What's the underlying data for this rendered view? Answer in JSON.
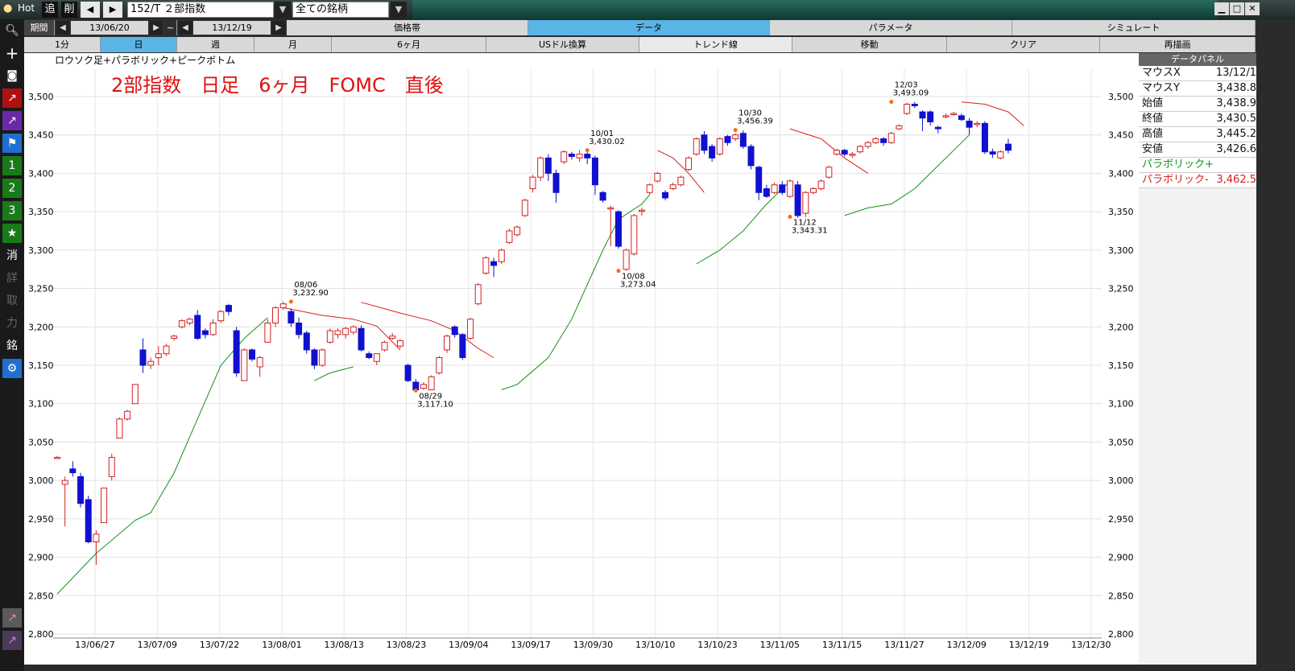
{
  "titlebar": {
    "hot": "Hot",
    "add": "追",
    "del": "削",
    "symbol": "152/T ２部指数",
    "universe": "全ての銘柄"
  },
  "period": {
    "label": "期間",
    "start": "13/06/20",
    "sep": "~",
    "end": "13/12/19"
  },
  "top_tabs": [
    "価格帯",
    "データ",
    "パラメータ",
    "シミュレート"
  ],
  "timeframes": [
    "1分",
    "日",
    "週",
    "月",
    "6ヶ月",
    "USドル換算"
  ],
  "tools": [
    "トレンド線",
    "移動",
    "クリア",
    "再描画"
  ],
  "left_buttons": [
    "1",
    "2",
    "3",
    "消",
    "詳",
    "取",
    "力",
    "銘"
  ],
  "chart": {
    "indicator_label": "ロウソク足+パラボリック+ピークボトム",
    "headline": "2部指数　日足　6ヶ月　FOMC　直後"
  },
  "panel": {
    "title": "データパネル",
    "rows": [
      {
        "k": "マウスX",
        "v": "13/12/1"
      },
      {
        "k": "マウスY",
        "v": "3,438.8"
      },
      {
        "k": "始値",
        "v": "3,438.9"
      },
      {
        "k": "終値",
        "v": "3,430.5"
      },
      {
        "k": "高値",
        "v": "3,445.2"
      },
      {
        "k": "安値",
        "v": "3,426.6"
      }
    ],
    "sar_plus": "パラボリック+",
    "sar_minus": "パラボリック-",
    "sar_minus_value": "3,462.5"
  },
  "colors": {
    "up": "#d42020",
    "down": "#1010d0",
    "sar_up": "#189018",
    "sar_down": "#d42020",
    "peak": "#ff6a00",
    "headline": "#e01010"
  },
  "chart_data": {
    "type": "candlestick",
    "ylim": [
      2800,
      3550
    ],
    "y_ticks": [
      "3,500",
      "3,450",
      "3,400",
      "3,350",
      "3,300",
      "3,250",
      "3,200",
      "3,150",
      "3,100",
      "3,050",
      "3,000",
      "2,950",
      "2,900",
      "2,850",
      "2,800"
    ],
    "x_ticks": [
      "13/06/27",
      "13/07/09",
      "13/07/22",
      "13/08/01",
      "13/08/13",
      "13/08/23",
      "13/09/04",
      "13/09/17",
      "13/09/30",
      "13/10/10",
      "13/10/23",
      "13/11/05",
      "13/11/15",
      "13/11/27",
      "13/12/09",
      "13/12/19",
      "13/12/30"
    ],
    "peaks": [
      {
        "date": "08/06",
        "value": "3,232.90",
        "price": 3232.9,
        "idx": 30,
        "type": "peak"
      },
      {
        "date": "08/29",
        "value": "3,117.10",
        "price": 3117.1,
        "idx": 46,
        "type": "bottom"
      },
      {
        "date": "10/01",
        "value": "3,430.02",
        "price": 3430.02,
        "idx": 68,
        "type": "peak"
      },
      {
        "date": "10/08",
        "value": "3,273.04",
        "price": 3273.04,
        "idx": 72,
        "type": "bottom"
      },
      {
        "date": "10/30",
        "value": "3,456.39",
        "price": 3456.39,
        "idx": 87,
        "type": "peak"
      },
      {
        "date": "11/12",
        "value": "3,343.31",
        "price": 3343.31,
        "idx": 94,
        "type": "bottom"
      },
      {
        "date": "12/03",
        "value": "3,493.09",
        "price": 3493.09,
        "idx": 107,
        "type": "peak"
      }
    ],
    "candles": [
      [
        3030,
        3030,
        3028,
        3032
      ],
      [
        2995,
        3000,
        2940,
        3005
      ],
      [
        3015,
        3010,
        3005,
        3025
      ],
      [
        3005,
        2970,
        2965,
        3010
      ],
      [
        2975,
        2920,
        2918,
        2980
      ],
      [
        2920,
        2930,
        2890,
        2935
      ],
      [
        2945,
        2990,
        2945,
        2990
      ],
      [
        3005,
        3030,
        3000,
        3035
      ],
      [
        3055,
        3080,
        3055,
        3082
      ],
      [
        3080,
        3090,
        3078,
        3092
      ],
      [
        3100,
        3125,
        3100,
        3125
      ],
      [
        3170,
        3150,
        3140,
        3185
      ],
      [
        3150,
        3155,
        3145,
        3160
      ],
      [
        3160,
        3165,
        3150,
        3175
      ],
      [
        3165,
        3175,
        3162,
        3178
      ],
      [
        3185,
        3188,
        3182,
        3190
      ],
      [
        3200,
        3208,
        3198,
        3210
      ],
      [
        3205,
        3210,
        3202,
        3212
      ],
      [
        3215,
        3185,
        3183,
        3222
      ],
      [
        3195,
        3190,
        3185,
        3198
      ],
      [
        3190,
        3205,
        3188,
        3210
      ],
      [
        3208,
        3220,
        3205,
        3222
      ],
      [
        3228,
        3220,
        3215,
        3230
      ],
      [
        3195,
        3140,
        3135,
        3200
      ],
      [
        3130,
        3170,
        3130,
        3172
      ],
      [
        3170,
        3158,
        3155,
        3172
      ],
      [
        3148,
        3160,
        3135,
        3162
      ],
      [
        3180,
        3205,
        3180,
        3210
      ],
      [
        3205,
        3225,
        3200,
        3227
      ],
      [
        3225,
        3230,
        3222,
        3233
      ],
      [
        3220,
        3205,
        3200,
        3224
      ],
      [
        3205,
        3190,
        3185,
        3212
      ],
      [
        3192,
        3170,
        3165,
        3195
      ],
      [
        3170,
        3150,
        3145,
        3172
      ],
      [
        3150,
        3170,
        3148,
        3172
      ],
      [
        3180,
        3195,
        3178,
        3198
      ],
      [
        3190,
        3195,
        3185,
        3198
      ],
      [
        3190,
        3198,
        3185,
        3200
      ],
      [
        3193,
        3200,
        3190,
        3202
      ],
      [
        3198,
        3170,
        3168,
        3202
      ],
      [
        3165,
        3160,
        3158,
        3168
      ],
      [
        3155,
        3165,
        3150,
        3165
      ],
      [
        3170,
        3180,
        3168,
        3182
      ],
      [
        3185,
        3188,
        3183,
        3192
      ],
      [
        3175,
        3182,
        3172,
        3184
      ],
      [
        3150,
        3130,
        3128,
        3152
      ],
      [
        3128,
        3118,
        3117,
        3132
      ],
      [
        3120,
        3125,
        3118,
        3128
      ],
      [
        3118,
        3135,
        3118,
        3137
      ],
      [
        3140,
        3160,
        3138,
        3162
      ],
      [
        3170,
        3188,
        3166,
        3190
      ],
      [
        3200,
        3190,
        3186,
        3202
      ],
      [
        3190,
        3160,
        3157,
        3192
      ],
      [
        3185,
        3210,
        3183,
        3212
      ],
      [
        3230,
        3255,
        3228,
        3257
      ],
      [
        3270,
        3290,
        3268,
        3292
      ],
      [
        3285,
        3280,
        3265,
        3290
      ],
      [
        3285,
        3300,
        3282,
        3302
      ],
      [
        3310,
        3325,
        3308,
        3328
      ],
      [
        3320,
        3330,
        3318,
        3332
      ],
      [
        3345,
        3365,
        3343,
        3367
      ],
      [
        3380,
        3395,
        3375,
        3398
      ],
      [
        3395,
        3420,
        3390,
        3422
      ],
      [
        3420,
        3400,
        3390,
        3425
      ],
      [
        3400,
        3375,
        3362,
        3405
      ],
      [
        3415,
        3428,
        3412,
        3430
      ],
      [
        3425,
        3422,
        3418,
        3428
      ],
      [
        3420,
        3425,
        3415,
        3430
      ],
      [
        3425,
        3420,
        3412,
        3430
      ],
      [
        3420,
        3385,
        3372,
        3423
      ],
      [
        3375,
        3365,
        3362,
        3377
      ],
      [
        3355,
        3355,
        3305,
        3358
      ],
      [
        3350,
        3305,
        3302,
        3352
      ],
      [
        3275,
        3300,
        3273,
        3302
      ],
      [
        3295,
        3345,
        3293,
        3347
      ],
      [
        3352,
        3352,
        3345,
        3355
      ],
      [
        3375,
        3385,
        3372,
        3387
      ],
      [
        3390,
        3400,
        3388,
        3402
      ],
      [
        3375,
        3368,
        3365,
        3378
      ],
      [
        3380,
        3385,
        3378,
        3388
      ],
      [
        3385,
        3395,
        3383,
        3397
      ],
      [
        3405,
        3420,
        3403,
        3422
      ],
      [
        3425,
        3445,
        3423,
        3447
      ],
      [
        3450,
        3430,
        3425,
        3455
      ],
      [
        3435,
        3420,
        3415,
        3438
      ],
      [
        3425,
        3445,
        3423,
        3447
      ],
      [
        3448,
        3440,
        3436,
        3450
      ],
      [
        3445,
        3450,
        3442,
        3452
      ],
      [
        3452,
        3435,
        3432,
        3456
      ],
      [
        3435,
        3410,
        3405,
        3438
      ],
      [
        3408,
        3375,
        3365,
        3410
      ],
      [
        3380,
        3370,
        3368,
        3385
      ],
      [
        3375,
        3385,
        3373,
        3388
      ],
      [
        3385,
        3375,
        3372,
        3390
      ],
      [
        3370,
        3390,
        3368,
        3392
      ],
      [
        3385,
        3345,
        3342,
        3390
      ],
      [
        3348,
        3375,
        3343,
        3377
      ],
      [
        3375,
        3380,
        3373,
        3382
      ],
      [
        3380,
        3390,
        3378,
        3392
      ],
      [
        3395,
        3408,
        3393,
        3410
      ],
      [
        3425,
        3430,
        3423,
        3432
      ],
      [
        3430,
        3425,
        3422,
        3432
      ],
      [
        3425,
        3425,
        3420,
        3428
      ],
      [
        3428,
        3435,
        3426,
        3437
      ],
      [
        3435,
        3440,
        3432,
        3442
      ],
      [
        3440,
        3445,
        3438,
        3447
      ],
      [
        3445,
        3440,
        3436,
        3447
      ],
      [
        3440,
        3452,
        3438,
        3454
      ],
      [
        3458,
        3462,
        3456,
        3464
      ],
      [
        3478,
        3490,
        3476,
        3492
      ],
      [
        3490,
        3488,
        3485,
        3493
      ],
      [
        3480,
        3472,
        3455,
        3482
      ],
      [
        3480,
        3467,
        3462,
        3482
      ],
      [
        3460,
        3458,
        3452,
        3462
      ],
      [
        3475,
        3475,
        3472,
        3478
      ],
      [
        3478,
        3478,
        3475,
        3480
      ],
      [
        3475,
        3470,
        3468,
        3478
      ],
      [
        3468,
        3460,
        3450,
        3472
      ],
      [
        3465,
        3465,
        3460,
        3468
      ],
      [
        3465,
        3428,
        3425,
        3468
      ],
      [
        3428,
        3425,
        3420,
        3432
      ],
      [
        3420,
        3428,
        3418,
        3430
      ],
      [
        3438,
        3430,
        3426,
        3445
      ]
    ],
    "sar": [
      {
        "type": "up",
        "pts": [
          [
            0,
            2852
          ],
          [
            5,
            2905
          ],
          [
            10,
            2948
          ],
          [
            12,
            2958
          ],
          [
            15,
            3010
          ],
          [
            18,
            3080
          ],
          [
            21,
            3150
          ],
          [
            24,
            3185
          ],
          [
            27,
            3212
          ]
        ]
      },
      {
        "type": "down",
        "pts": [
          [
            29,
            3225
          ],
          [
            34,
            3215
          ],
          [
            38,
            3210
          ],
          [
            41,
            3201
          ],
          [
            44,
            3170
          ]
        ]
      },
      {
        "type": "up",
        "pts": [
          [
            33,
            3130
          ],
          [
            35,
            3140
          ],
          [
            38,
            3148
          ]
        ]
      },
      {
        "type": "down",
        "pts": [
          [
            39,
            3232
          ],
          [
            44,
            3218
          ],
          [
            48,
            3208
          ],
          [
            51,
            3195
          ],
          [
            54,
            3172
          ],
          [
            56,
            3160
          ]
        ]
      },
      {
        "type": "up",
        "pts": [
          [
            57,
            3118
          ],
          [
            59,
            3125
          ],
          [
            63,
            3160
          ],
          [
            66,
            3210
          ],
          [
            70,
            3300
          ],
          [
            72,
            3340
          ],
          [
            75,
            3360
          ],
          [
            76,
            3372
          ]
        ]
      },
      {
        "type": "down",
        "pts": [
          [
            77,
            3430
          ],
          [
            79,
            3420
          ],
          [
            81,
            3400
          ],
          [
            83,
            3375
          ]
        ]
      },
      {
        "type": "up",
        "pts": [
          [
            82,
            3282
          ],
          [
            85,
            3300
          ],
          [
            88,
            3325
          ],
          [
            91,
            3360
          ],
          [
            94,
            3390
          ]
        ]
      },
      {
        "type": "down",
        "pts": [
          [
            94,
            3458
          ],
          [
            98,
            3445
          ],
          [
            101,
            3420
          ],
          [
            104,
            3400
          ]
        ]
      },
      {
        "type": "up",
        "pts": [
          [
            101,
            3345
          ],
          [
            104,
            3355
          ],
          [
            107,
            3360
          ],
          [
            110,
            3380
          ],
          [
            113,
            3410
          ],
          [
            116,
            3440
          ],
          [
            117,
            3450
          ]
        ]
      },
      {
        "type": "down",
        "pts": [
          [
            116,
            3493
          ],
          [
            119,
            3490
          ],
          [
            122,
            3480
          ],
          [
            124,
            3462
          ]
        ]
      }
    ]
  }
}
